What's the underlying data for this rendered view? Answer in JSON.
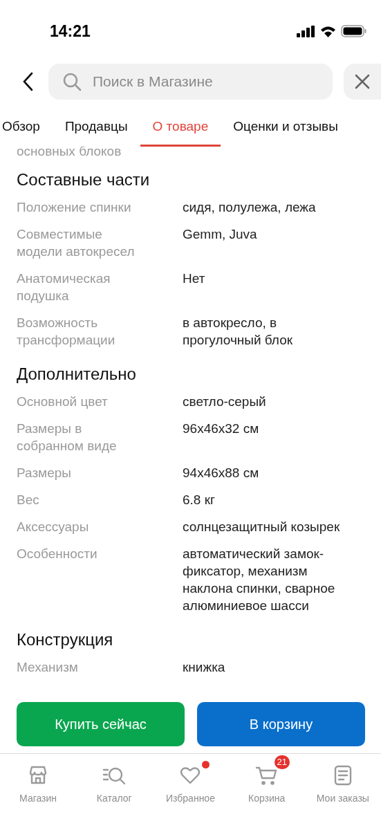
{
  "status_bar": {
    "time": "14:21"
  },
  "search": {
    "placeholder": "Поиск в Магазине"
  },
  "tabs": [
    {
      "label": "Обзор",
      "selected": false
    },
    {
      "label": "Продавцы",
      "selected": false
    },
    {
      "label": "О товаре",
      "selected": true
    },
    {
      "label": "Оценки и отзывы",
      "selected": false
    }
  ],
  "content": {
    "continued_text": "основных блоков",
    "sections": [
      {
        "title": "Составные части",
        "rows": [
          {
            "label": "Положение спинки",
            "value": "сидя, полулежа, лежа"
          },
          {
            "label": "Совместимые модели автокресел",
            "value": "Gemm, Juva"
          },
          {
            "label": "Анатомическая подушка",
            "value": "Нет"
          },
          {
            "label": "Возможность трансформации",
            "value": "в автокресло, в прогулочный блок"
          }
        ]
      },
      {
        "title": "Дополнительно",
        "rows": [
          {
            "label": "Основной цвет",
            "value": "светло-серый"
          },
          {
            "label": "Размеры в собранном виде",
            "value": "96x46x32 см"
          },
          {
            "label": "Размеры",
            "value": "94x46x88 см"
          },
          {
            "label": "Вес",
            "value": "6.8 кг"
          },
          {
            "label": "Аксессуары",
            "value": "солнцезащитный козырек"
          },
          {
            "label": "Особенности",
            "value": "автоматический замок-фиксатор, механизм наклона спинки, сварное алюминиевое шасси"
          }
        ]
      },
      {
        "title": "Конструкция",
        "rows": [
          {
            "label": "Механизм",
            "value": "книжка"
          }
        ]
      }
    ]
  },
  "actions": [
    {
      "label": "Купить сейчас",
      "kind": "buy"
    },
    {
      "label": "В корзину",
      "kind": "cart"
    }
  ],
  "bottom_nav": [
    {
      "label": "Магазин",
      "kind": "store",
      "dot": false
    },
    {
      "label": "Каталог",
      "kind": "catalog",
      "dot": false
    },
    {
      "label": "Избранное",
      "kind": "favorites",
      "dot": true
    },
    {
      "label": "Корзина",
      "kind": "cart",
      "dot": false,
      "badge": "21"
    },
    {
      "label": "Мои заказы",
      "kind": "orders",
      "dot": false
    }
  ]
}
